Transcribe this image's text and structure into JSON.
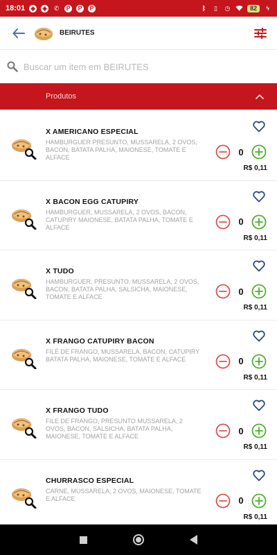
{
  "status_bar": {
    "time": "18:01",
    "battery": "82",
    "icons": [
      "shield-icon",
      "shield-icon",
      "phone-icon",
      "p-app-icon",
      "p-app-icon",
      "p-app-icon",
      "bluetooth-icon",
      "vibrate-icon",
      "alarm-icon",
      "wifi-icon",
      "battery-icon",
      "charging-icon"
    ]
  },
  "header": {
    "store_name": "BEIRUTES",
    "back_icon": "arrow-left-icon",
    "filter_icon": "sliders-icon"
  },
  "search": {
    "placeholder": "Buscar um item em BEIRUTES",
    "value": ""
  },
  "section": {
    "title": "Produtos",
    "expanded": true
  },
  "items": [
    {
      "name": "X AMERICANO ESPECIAL",
      "description": "HAMBURGUER PRESUNTO, MUSSARELA, 2 OVOS, BACON, BATATA PALHA, MAIONESE, TOMATE E ALFACE",
      "quantity": "0",
      "price": "R$ 0,11"
    },
    {
      "name": "X BACON EGG CATUPIRY",
      "description": "HAMBURGUER, MUSSARELA, 2 OVOS, BACON, CATUPIRY MAIONESE, BATATA PALHA, TOMATE E ALFACE",
      "quantity": "0",
      "price": "R$ 0,11"
    },
    {
      "name": "X TUDO",
      "description": "HAMBURGUER, PRESUNTO, MUSSARELA, 2 OVOS, BACON, BATATA PALHA, SALSICHA, MAIONESE, TOMATE E ALFACE",
      "quantity": "0",
      "price": "R$ 0,11"
    },
    {
      "name": "X FRANGO CATUPIRY BACON",
      "description": "FILÉ DE FRANGO, MUSSARELA, BACON, CATUPIRY BATATA PALHA, MAIONESE, TOMATE E ALFACE",
      "quantity": "0",
      "price": "R$ 0,11"
    },
    {
      "name": "X FRANGO TUDO",
      "description": "FILE DE FRANGO, PRESUNTO MUSSARELA, 2 OVOS, BACON, SALSICHA, BATATA PALHA, MAIONESE, TOMATE E ALFACE",
      "quantity": "0",
      "price": "R$ 0,11"
    },
    {
      "name": "CHURRASCO ESPECIAL",
      "description": "CARNE, MUSSARELA, 2 OVOS, MAIONESE, TOMATE E ALFACE",
      "quantity": "0",
      "price": "R$ 0,11"
    }
  ],
  "colors": {
    "brand_red": "#c4161c",
    "minus_red": "#d9534f",
    "plus_green": "#4caf2a",
    "heart_blue": "#2b4a7a"
  },
  "nav_bar": {
    "buttons": [
      "recents-square-icon",
      "home-circle-icon",
      "back-triangle-icon"
    ]
  }
}
